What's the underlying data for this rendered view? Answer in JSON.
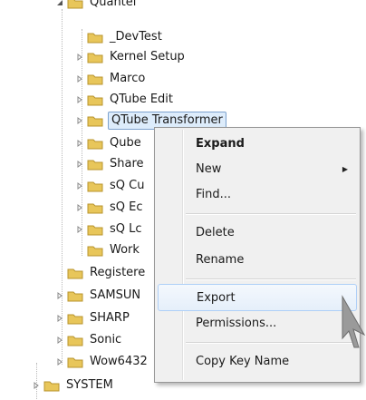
{
  "tree": {
    "top_cut": "Quantel",
    "quantel_children": [
      "_DevTest",
      "Kernel Setup",
      "Marco",
      "QTube Edit",
      "QTube Transformer",
      "Qube",
      "Share",
      "sQ Cu",
      "sQ Ec",
      "sQ Lc",
      "Work"
    ],
    "siblings": [
      "Registere",
      "SAMSUN",
      "SHARP",
      "Sonic",
      "Wow6432"
    ],
    "root": "SYSTEM",
    "selected": "QTube Transformer"
  },
  "context_menu": {
    "expand": "Expand",
    "new": "New",
    "find": "Find...",
    "delete": "Delete",
    "rename": "Rename",
    "export": "Export",
    "permissions": "Permissions...",
    "copy_key_name": "Copy Key Name",
    "hovered": "Export"
  },
  "colors": {
    "folder_yellow": "#e8c65a",
    "selection_bg": "#ddecfb",
    "menu_bg": "#f0f0f0",
    "hover_border": "#aecff7"
  }
}
